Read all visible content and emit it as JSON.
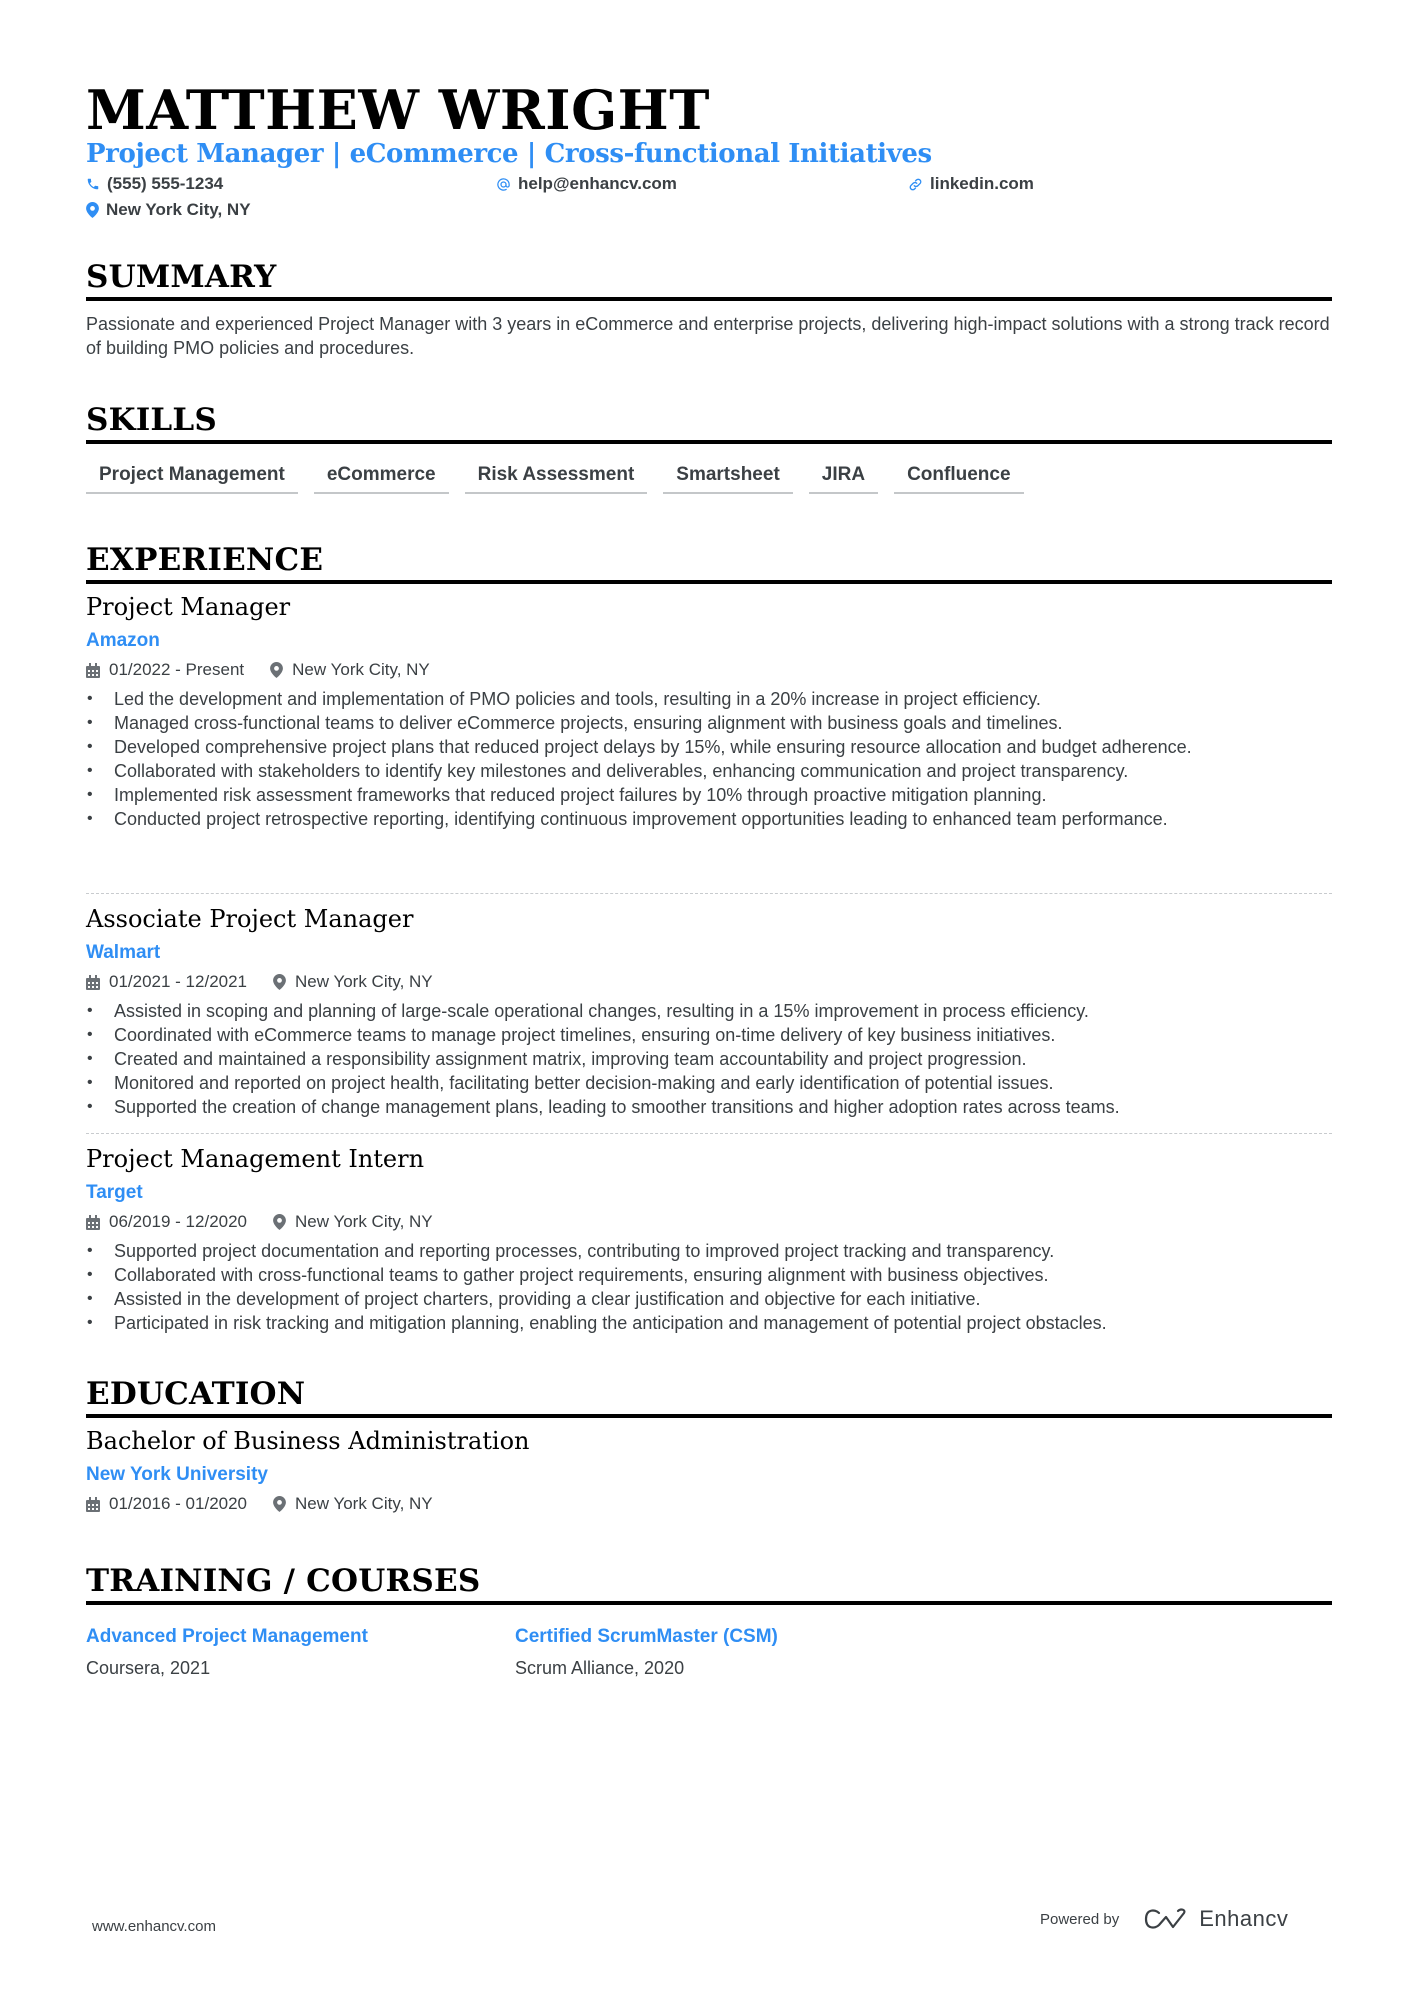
{
  "header": {
    "name": "MATTHEW WRIGHT",
    "headline": "Project Manager | eCommerce | Cross-functional Initiatives",
    "contacts": {
      "phone": {
        "icon": "phone-icon",
        "text": "(555) 555-1234"
      },
      "email": {
        "icon": "at-icon",
        "text": "help@enhancv.com"
      },
      "website": {
        "icon": "link-icon",
        "text": "linkedin.com"
      },
      "location": {
        "icon": "map-pin-icon",
        "text": "New York City, NY"
      }
    }
  },
  "summary": {
    "title": "SUMMARY",
    "text": "Passionate and experienced Project Manager with 3 years in eCommerce and enterprise projects, delivering high-impact solutions with a strong track record of building PMO policies and procedures."
  },
  "skills": {
    "title": "SKILLS",
    "items": [
      "Project Management",
      "eCommerce",
      "Risk Assessment",
      "Smartsheet",
      "JIRA",
      "Confluence"
    ]
  },
  "experience": {
    "title": "EXPERIENCE",
    "jobs": [
      {
        "title": "Project Manager",
        "company": "Amazon",
        "dates": "01/2022 - Present",
        "location": "New York City, NY",
        "bullets": [
          "Led the development and implementation of PMO policies and tools, resulting in a 20% increase in project efficiency.",
          "Managed cross-functional teams to deliver eCommerce projects, ensuring alignment with business goals and timelines.",
          "Developed comprehensive project plans that reduced project delays by 15%, while ensuring resource allocation and budget adherence.",
          "Collaborated with stakeholders to identify key milestones and deliverables, enhancing communication and project transparency.",
          "Implemented risk assessment frameworks that reduced project failures by 10% through proactive mitigation planning.",
          "Conducted project retrospective reporting, identifying continuous improvement opportunities leading to enhanced team performance."
        ]
      },
      {
        "title": "Associate Project Manager",
        "company": "Walmart",
        "dates": "01/2021 - 12/2021",
        "location": "New York City, NY",
        "bullets": [
          "Assisted in scoping and planning of large-scale operational changes, resulting in a 15% improvement in process efficiency.",
          "Coordinated with eCommerce teams to manage project timelines, ensuring on-time delivery of key business initiatives.",
          "Created and maintained a responsibility assignment matrix, improving team accountability and project progression.",
          "Monitored and reported on project health, facilitating better decision-making and early identification of potential issues.",
          "Supported the creation of change management plans, leading to smoother transitions and higher adoption rates across teams."
        ]
      },
      {
        "title": "Project Management Intern",
        "company": "Target",
        "dates": "06/2019 - 12/2020",
        "location": "New York City, NY",
        "bullets": [
          "Supported project documentation and reporting processes, contributing to improved project tracking and transparency.",
          "Collaborated with cross-functional teams to gather project requirements, ensuring alignment with business objectives.",
          "Assisted in the development of project charters, providing a clear justification and objective for each initiative.",
          "Participated in risk tracking and mitigation planning, enabling the anticipation and management of potential project obstacles."
        ]
      }
    ]
  },
  "education": {
    "title": "EDUCATION",
    "degree": "Bachelor of Business Administration",
    "school": "New York University",
    "dates": "01/2016 - 01/2020",
    "location": "New York City, NY"
  },
  "training": {
    "title": "TRAINING / COURSES",
    "courses": [
      {
        "title": "Advanced Project Management",
        "provider": "Coursera, 2021"
      },
      {
        "title": "Certified ScrumMaster (CSM)",
        "provider": "Scrum Alliance, 2020"
      }
    ]
  },
  "footer": {
    "website": "www.enhancv.com",
    "powered_by": "Powered by",
    "brand": "Enhancv"
  },
  "colors": {
    "accent": "#2f8ef4",
    "text": "#3b4044",
    "heading": "#000000"
  }
}
